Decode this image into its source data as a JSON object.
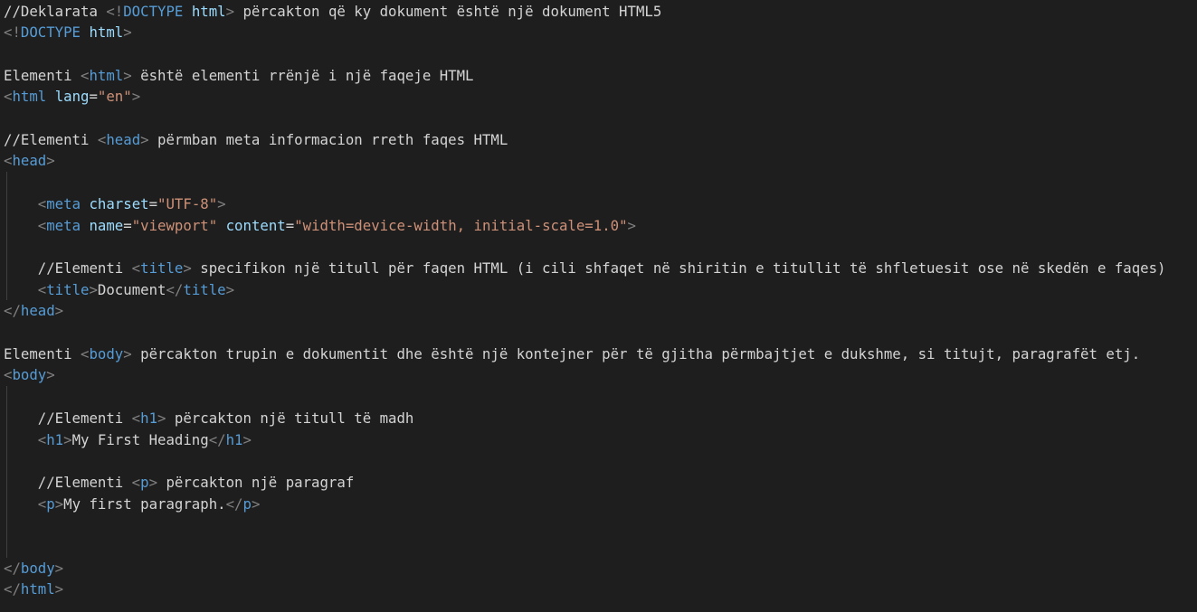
{
  "editor": {
    "lines": [
      [
        {
          "t": "//Deklarata ",
          "c": "txt"
        },
        {
          "t": "<!",
          "c": "br"
        },
        {
          "t": "DOCTYPE",
          "c": "tag"
        },
        {
          "t": " ",
          "c": "txt"
        },
        {
          "t": "html",
          "c": "attr"
        },
        {
          "t": ">",
          "c": "br"
        },
        {
          "t": " përcakton që ky dokument është një dokument HTML5",
          "c": "txt"
        }
      ],
      [
        {
          "t": "<!",
          "c": "br"
        },
        {
          "t": "DOCTYPE",
          "c": "tag"
        },
        {
          "t": " ",
          "c": "txt"
        },
        {
          "t": "html",
          "c": "attr"
        },
        {
          "t": ">",
          "c": "br"
        }
      ],
      [],
      [
        {
          "t": "Elementi ",
          "c": "txt"
        },
        {
          "t": "<",
          "c": "br"
        },
        {
          "t": "html",
          "c": "tag"
        },
        {
          "t": ">",
          "c": "br"
        },
        {
          "t": " është elementi rrënjë i një faqeje HTML",
          "c": "txt"
        }
      ],
      [
        {
          "t": "<",
          "c": "br"
        },
        {
          "t": "html",
          "c": "tag"
        },
        {
          "t": " ",
          "c": "txt"
        },
        {
          "t": "lang",
          "c": "attr"
        },
        {
          "t": "=",
          "c": "txt"
        },
        {
          "t": "\"en\"",
          "c": "str"
        },
        {
          "t": ">",
          "c": "br"
        }
      ],
      [],
      [
        {
          "t": "//Elementi ",
          "c": "txt"
        },
        {
          "t": "<",
          "c": "br"
        },
        {
          "t": "head",
          "c": "tag"
        },
        {
          "t": ">",
          "c": "br"
        },
        {
          "t": " përmban meta informacion rreth faqes HTML",
          "c": "txt"
        }
      ],
      [
        {
          "t": "<",
          "c": "br"
        },
        {
          "t": "head",
          "c": "tag"
        },
        {
          "t": ">",
          "c": "br"
        }
      ],
      [],
      [
        {
          "t": "    ",
          "c": "txt"
        },
        {
          "t": "<",
          "c": "br"
        },
        {
          "t": "meta",
          "c": "tag"
        },
        {
          "t": " ",
          "c": "txt"
        },
        {
          "t": "charset",
          "c": "attr"
        },
        {
          "t": "=",
          "c": "txt"
        },
        {
          "t": "\"UTF-8\"",
          "c": "str"
        },
        {
          "t": ">",
          "c": "br"
        }
      ],
      [
        {
          "t": "    ",
          "c": "txt"
        },
        {
          "t": "<",
          "c": "br"
        },
        {
          "t": "meta",
          "c": "tag"
        },
        {
          "t": " ",
          "c": "txt"
        },
        {
          "t": "name",
          "c": "attr"
        },
        {
          "t": "=",
          "c": "txt"
        },
        {
          "t": "\"viewport\"",
          "c": "str"
        },
        {
          "t": " ",
          "c": "txt"
        },
        {
          "t": "content",
          "c": "attr"
        },
        {
          "t": "=",
          "c": "txt"
        },
        {
          "t": "\"width=device-width, initial-scale=1.0\"",
          "c": "str"
        },
        {
          "t": ">",
          "c": "br"
        }
      ],
      [],
      [
        {
          "t": "    //Elementi ",
          "c": "txt"
        },
        {
          "t": "<",
          "c": "br"
        },
        {
          "t": "title",
          "c": "tag"
        },
        {
          "t": ">",
          "c": "br"
        },
        {
          "t": " specifikon një titull për faqen HTML (i cili shfaqet në shiritin e titullit të shfletuesit ose në skedën e faqes)",
          "c": "txt"
        }
      ],
      [
        {
          "t": "    ",
          "c": "txt"
        },
        {
          "t": "<",
          "c": "br"
        },
        {
          "t": "title",
          "c": "tag"
        },
        {
          "t": ">",
          "c": "br"
        },
        {
          "t": "Document",
          "c": "txt"
        },
        {
          "t": "</",
          "c": "br"
        },
        {
          "t": "title",
          "c": "tag"
        },
        {
          "t": ">",
          "c": "br"
        }
      ],
      [
        {
          "t": "</",
          "c": "br"
        },
        {
          "t": "head",
          "c": "tag"
        },
        {
          "t": ">",
          "c": "br"
        }
      ],
      [],
      [
        {
          "t": "Elementi ",
          "c": "txt"
        },
        {
          "t": "<",
          "c": "br"
        },
        {
          "t": "body",
          "c": "tag"
        },
        {
          "t": ">",
          "c": "br"
        },
        {
          "t": " përcakton trupin e dokumentit dhe është një kontejner për të gjitha përmbajtjet e dukshme, si titujt, paragrafët etj.",
          "c": "txt"
        }
      ],
      [
        {
          "t": "<",
          "c": "br"
        },
        {
          "t": "body",
          "c": "tag"
        },
        {
          "t": ">",
          "c": "br"
        }
      ],
      [],
      [
        {
          "t": "    //Elementi ",
          "c": "txt"
        },
        {
          "t": "<",
          "c": "br"
        },
        {
          "t": "h1",
          "c": "tag"
        },
        {
          "t": ">",
          "c": "br"
        },
        {
          "t": " përcakton një titull të madh",
          "c": "txt"
        }
      ],
      [
        {
          "t": "    ",
          "c": "txt"
        },
        {
          "t": "<",
          "c": "br"
        },
        {
          "t": "h1",
          "c": "tag"
        },
        {
          "t": ">",
          "c": "br"
        },
        {
          "t": "My First Heading",
          "c": "txt"
        },
        {
          "t": "</",
          "c": "br"
        },
        {
          "t": "h1",
          "c": "tag"
        },
        {
          "t": ">",
          "c": "br"
        }
      ],
      [],
      [
        {
          "t": "    //Elementi ",
          "c": "txt"
        },
        {
          "t": "<",
          "c": "br"
        },
        {
          "t": "p",
          "c": "tag"
        },
        {
          "t": ">",
          "c": "br"
        },
        {
          "t": " përcakton një paragraf",
          "c": "txt"
        }
      ],
      [
        {
          "t": "    ",
          "c": "txt"
        },
        {
          "t": "<",
          "c": "br"
        },
        {
          "t": "p",
          "c": "tag"
        },
        {
          "t": ">",
          "c": "br"
        },
        {
          "t": "My first paragraph.",
          "c": "txt"
        },
        {
          "t": "</",
          "c": "br"
        },
        {
          "t": "p",
          "c": "tag"
        },
        {
          "t": ">",
          "c": "br"
        }
      ],
      [],
      [],
      [
        {
          "t": "</",
          "c": "br"
        },
        {
          "t": "body",
          "c": "tag"
        },
        {
          "t": ">",
          "c": "br"
        }
      ],
      [
        {
          "t": "</",
          "c": "br"
        },
        {
          "t": "html",
          "c": "tag"
        },
        {
          "t": ">",
          "c": "br"
        }
      ]
    ],
    "colors": {
      "background": "#1e1e1e",
      "text": "#d4d4d4",
      "tag": "#569cd6",
      "bracket": "#808080",
      "attribute": "#9cdcfe",
      "string": "#ce9178",
      "indent_guide": "#404040"
    }
  }
}
